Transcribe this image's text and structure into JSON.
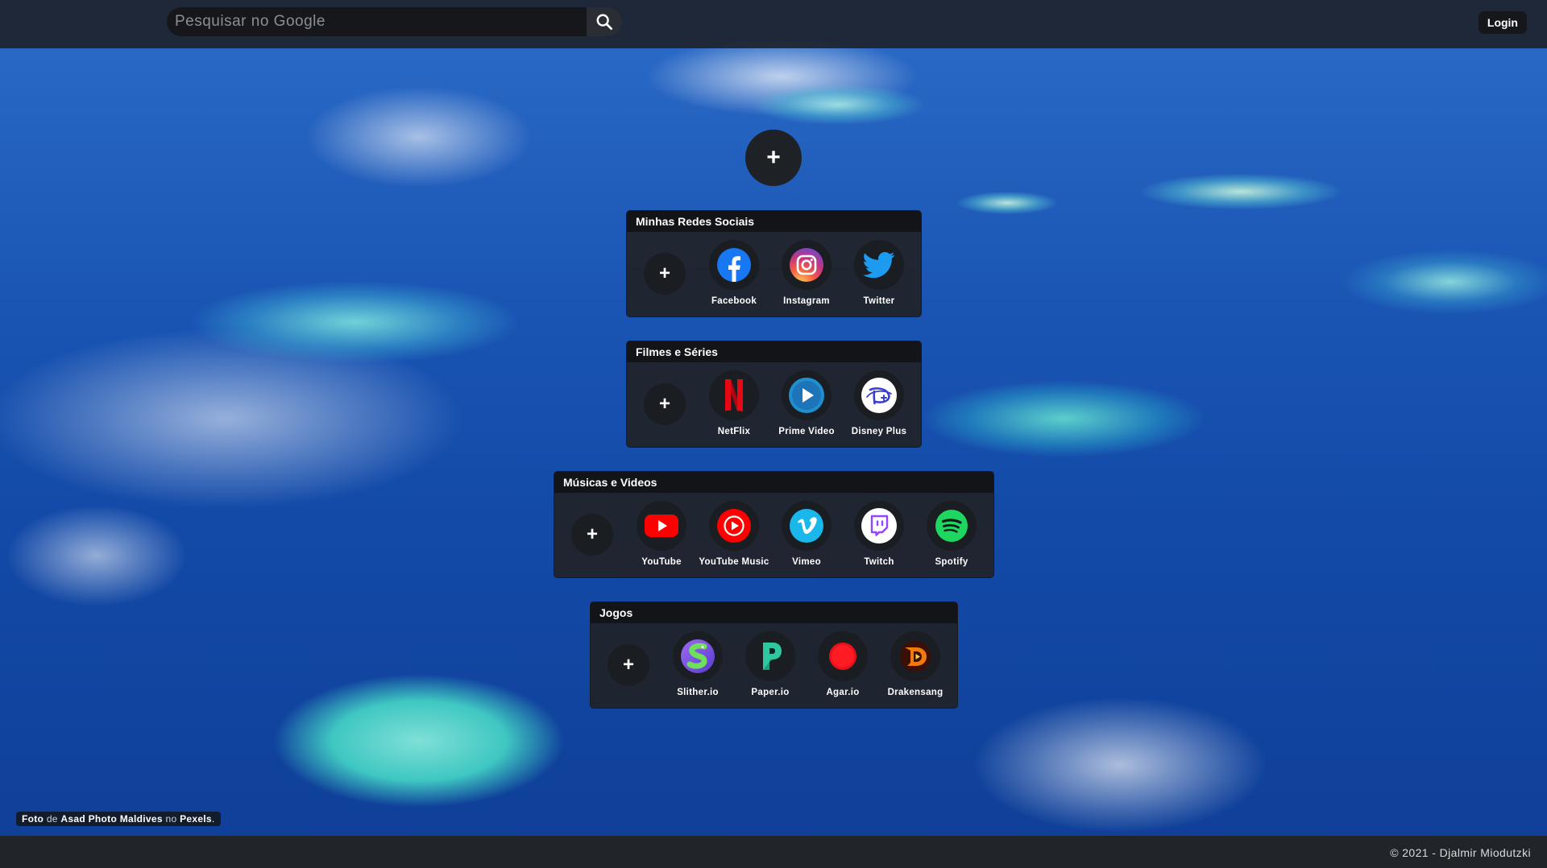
{
  "search": {
    "placeholder": "Pesquisar no Google"
  },
  "header": {
    "login_label": "Login"
  },
  "main": {
    "add_group_label": "+"
  },
  "groups": [
    {
      "title": "Minhas Redes Sociais",
      "add_label": "+",
      "items": [
        {
          "label": "Facebook",
          "icon": "facebook-icon"
        },
        {
          "label": "Instagram",
          "icon": "instagram-icon"
        },
        {
          "label": "Twitter",
          "icon": "twitter-icon"
        }
      ]
    },
    {
      "title": "Filmes e Séries",
      "add_label": "+",
      "items": [
        {
          "label": "NetFlix",
          "icon": "netflix-icon"
        },
        {
          "label": "Prime Video",
          "icon": "prime-video-icon"
        },
        {
          "label": "Disney Plus",
          "icon": "disney-plus-icon"
        }
      ]
    },
    {
      "title": "Músicas e Videos",
      "add_label": "+",
      "items": [
        {
          "label": "YouTube",
          "icon": "youtube-icon"
        },
        {
          "label": "YouTube Music",
          "icon": "youtube-music-icon"
        },
        {
          "label": "Vimeo",
          "icon": "vimeo-icon"
        },
        {
          "label": "Twitch",
          "icon": "twitch-icon"
        },
        {
          "label": "Spotify",
          "icon": "spotify-icon"
        }
      ]
    },
    {
      "title": "Jogos",
      "add_label": "+",
      "items": [
        {
          "label": "Slither.io",
          "icon": "slither-io-icon"
        },
        {
          "label": "Paper.io",
          "icon": "paper-io-icon"
        },
        {
          "label": "Agar.io",
          "icon": "agar-io-icon"
        },
        {
          "label": "Drakensang",
          "icon": "drakensang-icon"
        }
      ]
    }
  ],
  "credit": {
    "prefix": "Foto",
    "de": "de",
    "author": "Asad Photo Maldives",
    "no": "no",
    "site": "Pexels",
    "suffix": "."
  },
  "footer": {
    "copyright": "© 2021 - Djalmir Miodutzki"
  },
  "colors": {
    "facebook": "#1877f2",
    "twitter": "#1d9bf0",
    "netflix": "#e50914",
    "youtube": "#ff0000",
    "vimeo": "#1ab7ea",
    "twitch": "#9146ff",
    "spotify": "#1ed760"
  }
}
